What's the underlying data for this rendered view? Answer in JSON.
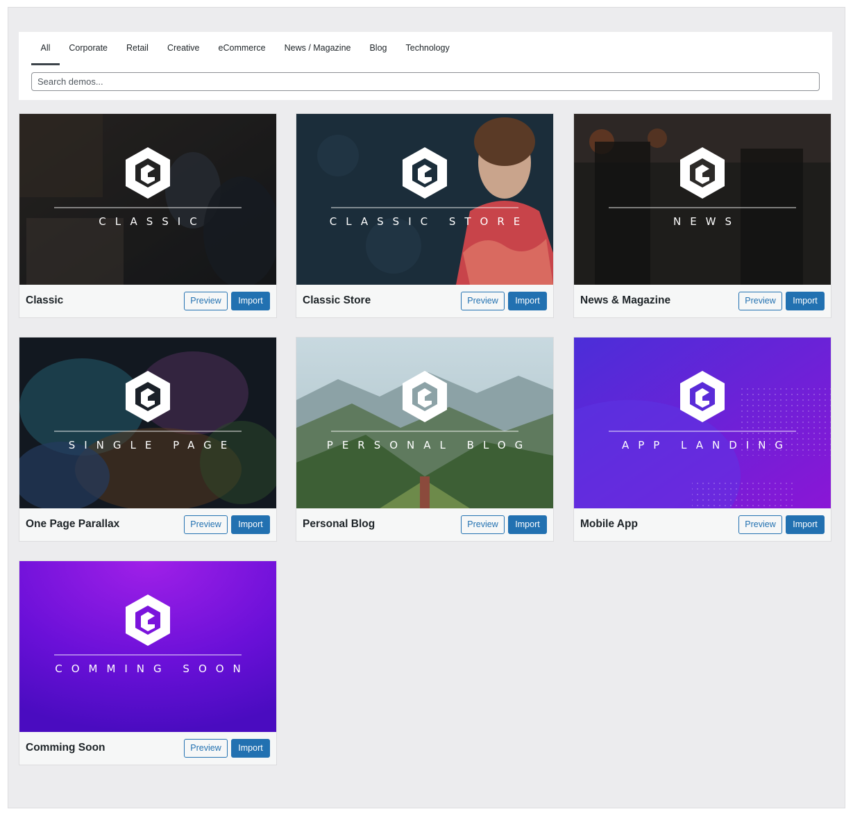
{
  "filters": {
    "tabs": [
      "All",
      "Corporate",
      "Retail",
      "Creative",
      "eCommerce",
      "News / Magazine",
      "Blog",
      "Technology"
    ],
    "active_tab": "All",
    "search_placeholder": "Search demos..."
  },
  "demos": [
    {
      "name": "Classic",
      "overlay": "CLASSIC",
      "preview_label": "Preview",
      "import_label": "Import"
    },
    {
      "name": "Classic Store",
      "overlay": "CLASSIC STORE",
      "preview_label": "Preview",
      "import_label": "Import"
    },
    {
      "name": "News & Magazine",
      "overlay": "NEWS",
      "preview_label": "Preview",
      "import_label": "Import"
    },
    {
      "name": "One Page Parallax",
      "overlay": "SINGLE PAGE",
      "preview_label": "Preview",
      "import_label": "Import"
    },
    {
      "name": "Personal Blog",
      "overlay": "PERSONAL BLOG",
      "preview_label": "Preview",
      "import_label": "Import"
    },
    {
      "name": "Mobile App",
      "overlay": "APP LANDING",
      "preview_label": "Preview",
      "import_label": "Import"
    },
    {
      "name": "Comming Soon",
      "overlay": "COMMING SOON",
      "preview_label": "Preview",
      "import_label": "Import"
    }
  ],
  "colors": {
    "primary": "#2271b1",
    "background": "#ececee",
    "card_footer": "#f6f7f7"
  }
}
